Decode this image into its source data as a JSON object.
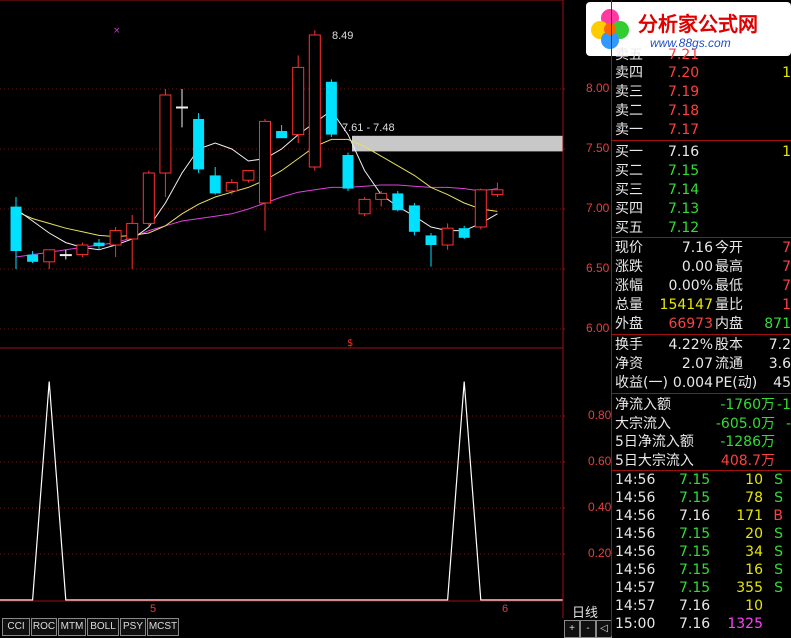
{
  "indicator_tabs": [
    "CCI",
    "ROC",
    "MTM",
    "BOLL",
    "PSY",
    "MCST"
  ],
  "period_label": "日线",
  "scroll_controls": [
    "+",
    "-",
    "◁",
    "▷"
  ],
  "logo": {
    "title": "分析家公式网",
    "url": "www.88gs.com"
  },
  "main_chart": {
    "y_ticks": [
      "8.00",
      "7.50",
      "7.00",
      "6.50",
      "6.00"
    ],
    "peak_label": "8.49",
    "band_label": "7.61 - 7.48",
    "x_ticks": [
      "5",
      "6"
    ]
  },
  "sub_chart": {
    "y_ticks": [
      "0.80",
      "0.60",
      "0.40",
      "0.20"
    ]
  },
  "quote": {
    "asks": [
      {
        "label": "卖五",
        "price": "7.21"
      },
      {
        "label": "卖四",
        "price": "7.20",
        "vol": "1"
      },
      {
        "label": "卖三",
        "price": "7.19"
      },
      {
        "label": "卖二",
        "price": "7.18"
      },
      {
        "label": "卖一",
        "price": "7.17"
      }
    ],
    "bids": [
      {
        "label": "买一",
        "price": "7.16",
        "vol": "1"
      },
      {
        "label": "买二",
        "price": "7.15"
      },
      {
        "label": "买三",
        "price": "7.14"
      },
      {
        "label": "买四",
        "price": "7.13"
      },
      {
        "label": "买五",
        "price": "7.12"
      }
    ],
    "stats": [
      {
        "l1": "现价",
        "v1": "7.16",
        "l2": "今开",
        "v2": "7"
      },
      {
        "l1": "涨跌",
        "v1": "0.00",
        "l2": "最高",
        "v2": "7"
      },
      {
        "l1": "涨幅",
        "v1": "0.00%",
        "l2": "最低",
        "v2": "7"
      },
      {
        "l1": "总量",
        "v1": "154147",
        "l2": "量比",
        "v2": "1"
      },
      {
        "l1": "外盘",
        "v1": "66973",
        "l2": "内盘",
        "v2": "871"
      }
    ],
    "stats2": [
      {
        "l1": "换手",
        "v1": "4.22%",
        "l2": "股本",
        "v2": "7.2"
      },
      {
        "l1": "净资",
        "v1": "2.07",
        "l2": "流通",
        "v2": "3.6"
      },
      {
        "l1": "收益(一)",
        "v1": "0.004",
        "l2": "PE(动)",
        "v2": "45"
      }
    ],
    "flows": [
      {
        "label": "净流入额",
        "value": "-1760万",
        "extra": "-1"
      },
      {
        "label": "大宗流入",
        "value": "-605.0万",
        "extra": "-"
      },
      {
        "label": "5日净流入额",
        "value": "-1286万",
        "extra": ""
      },
      {
        "label": "5日大宗流入",
        "value": "408.7万",
        "extra": ""
      }
    ],
    "ticks": [
      {
        "t": "14:56",
        "p": "7.15",
        "v": "10",
        "s": "S"
      },
      {
        "t": "14:56",
        "p": "7.15",
        "v": "78",
        "s": "S"
      },
      {
        "t": "14:56",
        "p": "7.16",
        "v": "171",
        "s": "B"
      },
      {
        "t": "14:56",
        "p": "7.15",
        "v": "20",
        "s": "S"
      },
      {
        "t": "14:56",
        "p": "7.15",
        "v": "34",
        "s": "S"
      },
      {
        "t": "14:56",
        "p": "7.15",
        "v": "16",
        "s": "S"
      },
      {
        "t": "14:57",
        "p": "7.15",
        "v": "355",
        "s": "S"
      },
      {
        "t": "14:57",
        "p": "7.16",
        "v": "10",
        "s": ""
      },
      {
        "t": "15:00",
        "p": "7.16",
        "v": "1325",
        "s": ""
      }
    ]
  },
  "chart_data": {
    "type": "candlestick",
    "ylim": [
      6.0,
      8.5
    ],
    "candles": [
      {
        "o": 7.02,
        "h": 7.1,
        "l": 6.5,
        "c": 6.65,
        "dir": "down"
      },
      {
        "o": 6.62,
        "h": 6.65,
        "l": 6.55,
        "c": 6.56,
        "dir": "down"
      },
      {
        "o": 6.56,
        "h": 6.66,
        "l": 6.5,
        "c": 6.66,
        "dir": "up"
      },
      {
        "o": 6.62,
        "h": 6.66,
        "l": 6.58,
        "c": 6.62,
        "dir": "flat"
      },
      {
        "o": 6.62,
        "h": 6.72,
        "l": 6.6,
        "c": 6.7,
        "dir": "up"
      },
      {
        "o": 6.72,
        "h": 6.75,
        "l": 6.66,
        "c": 6.69,
        "dir": "down"
      },
      {
        "o": 6.7,
        "h": 6.85,
        "l": 6.6,
        "c": 6.82,
        "dir": "up"
      },
      {
        "o": 6.75,
        "h": 6.95,
        "l": 6.5,
        "c": 6.88,
        "dir": "up"
      },
      {
        "o": 6.88,
        "h": 7.32,
        "l": 6.86,
        "c": 7.3,
        "dir": "up"
      },
      {
        "o": 7.3,
        "h": 8.0,
        "l": 7.1,
        "c": 7.95,
        "dir": "up"
      },
      {
        "o": 7.85,
        "h": 8.0,
        "l": 7.68,
        "c": 7.85,
        "dir": "flat"
      },
      {
        "o": 7.75,
        "h": 7.8,
        "l": 7.3,
        "c": 7.33,
        "dir": "down"
      },
      {
        "o": 7.28,
        "h": 7.35,
        "l": 7.12,
        "c": 7.13,
        "dir": "down"
      },
      {
        "o": 7.15,
        "h": 7.25,
        "l": 7.12,
        "c": 7.22,
        "dir": "up"
      },
      {
        "o": 7.24,
        "h": 7.3,
        "l": 7.22,
        "c": 7.32,
        "dir": "up"
      },
      {
        "o": 7.05,
        "h": 7.75,
        "l": 6.82,
        "c": 7.73,
        "dir": "up"
      },
      {
        "o": 7.65,
        "h": 7.7,
        "l": 7.6,
        "c": 7.59,
        "dir": "down"
      },
      {
        "o": 7.62,
        "h": 8.28,
        "l": 7.55,
        "c": 8.18,
        "dir": "up"
      },
      {
        "o": 7.35,
        "h": 8.49,
        "l": 7.32,
        "c": 8.45,
        "dir": "up"
      },
      {
        "o": 8.06,
        "h": 8.08,
        "l": 7.6,
        "c": 7.62,
        "dir": "down"
      },
      {
        "o": 7.45,
        "h": 7.47,
        "l": 7.15,
        "c": 7.17,
        "dir": "down"
      },
      {
        "o": 6.96,
        "h": 7.1,
        "l": 6.94,
        "c": 7.08,
        "dir": "up"
      },
      {
        "o": 7.08,
        "h": 7.15,
        "l": 7.02,
        "c": 7.13,
        "dir": "up"
      },
      {
        "o": 7.13,
        "h": 7.15,
        "l": 6.98,
        "c": 6.99,
        "dir": "down"
      },
      {
        "o": 7.03,
        "h": 7.05,
        "l": 6.78,
        "c": 6.81,
        "dir": "down"
      },
      {
        "o": 6.78,
        "h": 6.8,
        "l": 6.52,
        "c": 6.7,
        "dir": "down"
      },
      {
        "o": 6.7,
        "h": 6.88,
        "l": 6.66,
        "c": 6.84,
        "dir": "up"
      },
      {
        "o": 6.84,
        "h": 6.86,
        "l": 6.75,
        "c": 6.76,
        "dir": "down"
      },
      {
        "o": 6.85,
        "h": 7.17,
        "l": 6.83,
        "c": 7.16,
        "dir": "up"
      },
      {
        "o": 7.12,
        "h": 7.22,
        "l": 7.1,
        "c": 7.16,
        "dir": "up"
      }
    ],
    "ma_white": [
      7.0,
      6.9,
      6.8,
      6.72,
      6.68,
      6.66,
      6.7,
      6.75,
      6.85,
      7.05,
      7.3,
      7.5,
      7.55,
      7.5,
      7.4,
      7.42,
      7.5,
      7.62,
      7.72,
      7.82,
      7.62,
      7.32,
      7.12,
      7.02,
      6.94,
      6.85,
      6.82,
      6.82,
      6.88,
      6.96
    ],
    "ma_yellow": [
      6.98,
      6.92,
      6.88,
      6.84,
      6.81,
      6.78,
      6.77,
      6.78,
      6.8,
      6.86,
      6.96,
      7.04,
      7.1,
      7.14,
      7.18,
      7.24,
      7.32,
      7.42,
      7.52,
      7.58,
      7.58,
      7.52,
      7.44,
      7.36,
      7.28,
      7.18,
      7.12,
      7.05,
      7.0,
      6.98
    ],
    "ma_magenta": [
      6.6,
      6.62,
      6.64,
      6.66,
      6.68,
      6.7,
      6.72,
      6.76,
      6.82,
      6.86,
      6.9,
      6.92,
      6.94,
      6.96,
      7.0,
      7.05,
      7.1,
      7.14,
      7.16,
      7.18,
      7.18,
      7.19,
      7.2,
      7.2,
      7.19,
      7.18,
      7.18,
      7.17,
      7.15,
      7.17
    ],
    "resistance_band": [
      7.48,
      7.61
    ],
    "sub_series": [
      0,
      0,
      0.95,
      0,
      0,
      0,
      0,
      0,
      0,
      0,
      0,
      0,
      0,
      0,
      0,
      0,
      0,
      0,
      0,
      0,
      0,
      0,
      0,
      0,
      0,
      0,
      0,
      0.95,
      0,
      0
    ],
    "sub_ylim": [
      0,
      1.0
    ]
  }
}
